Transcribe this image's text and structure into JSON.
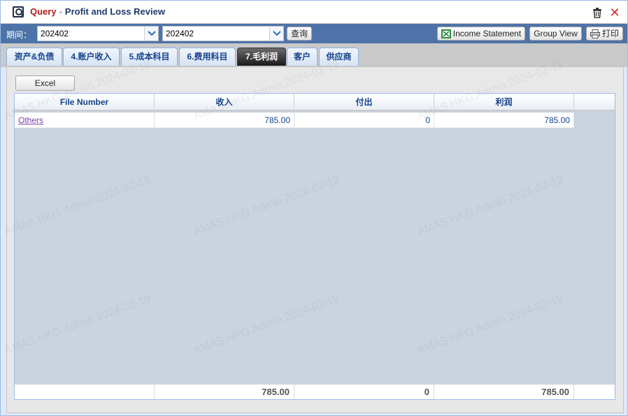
{
  "title": {
    "prefix": "Query",
    "separator": "-",
    "main": "Profit and Loss Review"
  },
  "toolbar": {
    "period_label": "期间：",
    "period_from": "202402",
    "period_to": "202402",
    "query_button": "查询",
    "income_statement_button": "Income Statement",
    "group_view_button": "Group View",
    "print_button": "打印"
  },
  "tabs": [
    {
      "label": "资产&负债",
      "active": false
    },
    {
      "label": "4.账户收入",
      "active": false
    },
    {
      "label": "5.成本科目",
      "active": false
    },
    {
      "label": "6.费用科目",
      "active": false
    },
    {
      "label": "7.毛利润",
      "active": true
    },
    {
      "label": "客户",
      "active": false
    },
    {
      "label": "供应商",
      "active": false
    }
  ],
  "excel_button": "Excel",
  "grid": {
    "columns": [
      "File Number",
      "收入",
      "付出",
      "利润"
    ],
    "rows": [
      {
        "file_number": "Others",
        "income": "785.00",
        "expense": "0",
        "profit": "785.00"
      }
    ],
    "totals": {
      "income": "785.00",
      "expense": "0",
      "profit": "785.00"
    }
  },
  "watermark_text": "AMAS.HKG.Admin 2024-02-19",
  "colors": {
    "toolbar": "#4d73a8",
    "title_query": "#b31b1b",
    "grid_body": "#c9d4df",
    "close": "#d42a2a"
  },
  "icons": {
    "title": "magnifier-window-icon",
    "trash": "trash-icon",
    "close": "close-icon",
    "excel": "excel-icon",
    "print": "printer-icon",
    "dropdown": "chevron-down-icon"
  }
}
